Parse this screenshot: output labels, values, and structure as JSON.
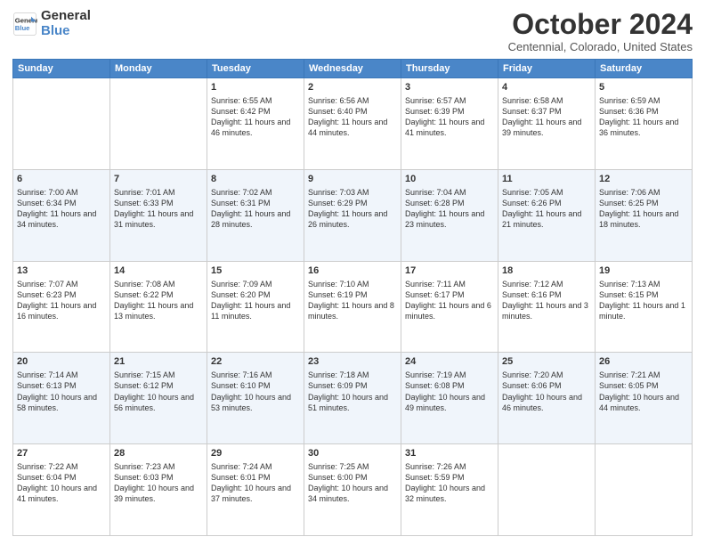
{
  "header": {
    "logo_line1": "General",
    "logo_line2": "Blue",
    "month_title": "October 2024",
    "subtitle": "Centennial, Colorado, United States"
  },
  "days_of_week": [
    "Sunday",
    "Monday",
    "Tuesday",
    "Wednesday",
    "Thursday",
    "Friday",
    "Saturday"
  ],
  "weeks": [
    [
      {
        "day": "",
        "info": ""
      },
      {
        "day": "",
        "info": ""
      },
      {
        "day": "1",
        "info": "Sunrise: 6:55 AM\nSunset: 6:42 PM\nDaylight: 11 hours and 46 minutes."
      },
      {
        "day": "2",
        "info": "Sunrise: 6:56 AM\nSunset: 6:40 PM\nDaylight: 11 hours and 44 minutes."
      },
      {
        "day": "3",
        "info": "Sunrise: 6:57 AM\nSunset: 6:39 PM\nDaylight: 11 hours and 41 minutes."
      },
      {
        "day": "4",
        "info": "Sunrise: 6:58 AM\nSunset: 6:37 PM\nDaylight: 11 hours and 39 minutes."
      },
      {
        "day": "5",
        "info": "Sunrise: 6:59 AM\nSunset: 6:36 PM\nDaylight: 11 hours and 36 minutes."
      }
    ],
    [
      {
        "day": "6",
        "info": "Sunrise: 7:00 AM\nSunset: 6:34 PM\nDaylight: 11 hours and 34 minutes."
      },
      {
        "day": "7",
        "info": "Sunrise: 7:01 AM\nSunset: 6:33 PM\nDaylight: 11 hours and 31 minutes."
      },
      {
        "day": "8",
        "info": "Sunrise: 7:02 AM\nSunset: 6:31 PM\nDaylight: 11 hours and 28 minutes."
      },
      {
        "day": "9",
        "info": "Sunrise: 7:03 AM\nSunset: 6:29 PM\nDaylight: 11 hours and 26 minutes."
      },
      {
        "day": "10",
        "info": "Sunrise: 7:04 AM\nSunset: 6:28 PM\nDaylight: 11 hours and 23 minutes."
      },
      {
        "day": "11",
        "info": "Sunrise: 7:05 AM\nSunset: 6:26 PM\nDaylight: 11 hours and 21 minutes."
      },
      {
        "day": "12",
        "info": "Sunrise: 7:06 AM\nSunset: 6:25 PM\nDaylight: 11 hours and 18 minutes."
      }
    ],
    [
      {
        "day": "13",
        "info": "Sunrise: 7:07 AM\nSunset: 6:23 PM\nDaylight: 11 hours and 16 minutes."
      },
      {
        "day": "14",
        "info": "Sunrise: 7:08 AM\nSunset: 6:22 PM\nDaylight: 11 hours and 13 minutes."
      },
      {
        "day": "15",
        "info": "Sunrise: 7:09 AM\nSunset: 6:20 PM\nDaylight: 11 hours and 11 minutes."
      },
      {
        "day": "16",
        "info": "Sunrise: 7:10 AM\nSunset: 6:19 PM\nDaylight: 11 hours and 8 minutes."
      },
      {
        "day": "17",
        "info": "Sunrise: 7:11 AM\nSunset: 6:17 PM\nDaylight: 11 hours and 6 minutes."
      },
      {
        "day": "18",
        "info": "Sunrise: 7:12 AM\nSunset: 6:16 PM\nDaylight: 11 hours and 3 minutes."
      },
      {
        "day": "19",
        "info": "Sunrise: 7:13 AM\nSunset: 6:15 PM\nDaylight: 11 hours and 1 minute."
      }
    ],
    [
      {
        "day": "20",
        "info": "Sunrise: 7:14 AM\nSunset: 6:13 PM\nDaylight: 10 hours and 58 minutes."
      },
      {
        "day": "21",
        "info": "Sunrise: 7:15 AM\nSunset: 6:12 PM\nDaylight: 10 hours and 56 minutes."
      },
      {
        "day": "22",
        "info": "Sunrise: 7:16 AM\nSunset: 6:10 PM\nDaylight: 10 hours and 53 minutes."
      },
      {
        "day": "23",
        "info": "Sunrise: 7:18 AM\nSunset: 6:09 PM\nDaylight: 10 hours and 51 minutes."
      },
      {
        "day": "24",
        "info": "Sunrise: 7:19 AM\nSunset: 6:08 PM\nDaylight: 10 hours and 49 minutes."
      },
      {
        "day": "25",
        "info": "Sunrise: 7:20 AM\nSunset: 6:06 PM\nDaylight: 10 hours and 46 minutes."
      },
      {
        "day": "26",
        "info": "Sunrise: 7:21 AM\nSunset: 6:05 PM\nDaylight: 10 hours and 44 minutes."
      }
    ],
    [
      {
        "day": "27",
        "info": "Sunrise: 7:22 AM\nSunset: 6:04 PM\nDaylight: 10 hours and 41 minutes."
      },
      {
        "day": "28",
        "info": "Sunrise: 7:23 AM\nSunset: 6:03 PM\nDaylight: 10 hours and 39 minutes."
      },
      {
        "day": "29",
        "info": "Sunrise: 7:24 AM\nSunset: 6:01 PM\nDaylight: 10 hours and 37 minutes."
      },
      {
        "day": "30",
        "info": "Sunrise: 7:25 AM\nSunset: 6:00 PM\nDaylight: 10 hours and 34 minutes."
      },
      {
        "day": "31",
        "info": "Sunrise: 7:26 AM\nSunset: 5:59 PM\nDaylight: 10 hours and 32 minutes."
      },
      {
        "day": "",
        "info": ""
      },
      {
        "day": "",
        "info": ""
      }
    ]
  ]
}
